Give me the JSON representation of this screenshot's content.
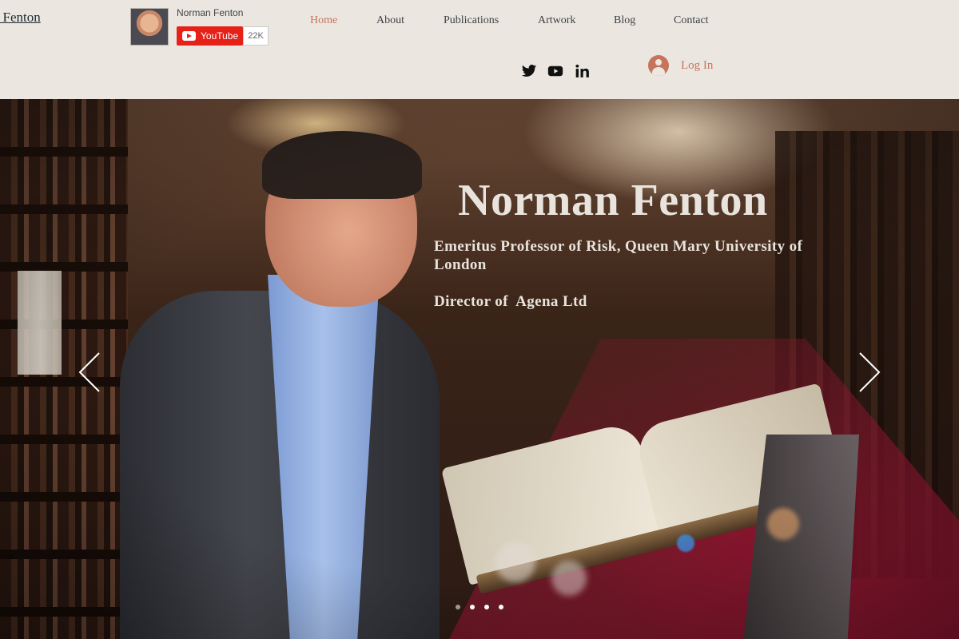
{
  "site": {
    "name": "man Fenton"
  },
  "youtube": {
    "channel_name": "Norman Fenton",
    "button_label": "YouTube",
    "subscriber_count": "22K"
  },
  "nav": {
    "items": [
      {
        "label": "Home",
        "active": true
      },
      {
        "label": "About",
        "active": false
      },
      {
        "label": "Publications",
        "active": false
      },
      {
        "label": "Artwork",
        "active": false
      },
      {
        "label": "Blog",
        "active": false
      },
      {
        "label": "Contact",
        "active": false
      }
    ]
  },
  "social": {
    "icons": [
      "twitter-icon",
      "youtube-icon",
      "linkedin-icon"
    ]
  },
  "login": {
    "label": "Log In",
    "icon": "user-avatar-icon"
  },
  "hero": {
    "title": "Norman Fenton",
    "subtitle_line1": "Emeritus Professor of Risk, Queen Mary University of London",
    "subtitle_line2": "Director of  Agena Ltd",
    "slides": {
      "count": 4,
      "active_index": 0
    }
  },
  "colors": {
    "accent": "#c6745c",
    "header_bg": "#ebe7e0",
    "nav_text": "#3c3f44",
    "hero_text": "#e8e3dc",
    "youtube_red": "#e62117"
  }
}
